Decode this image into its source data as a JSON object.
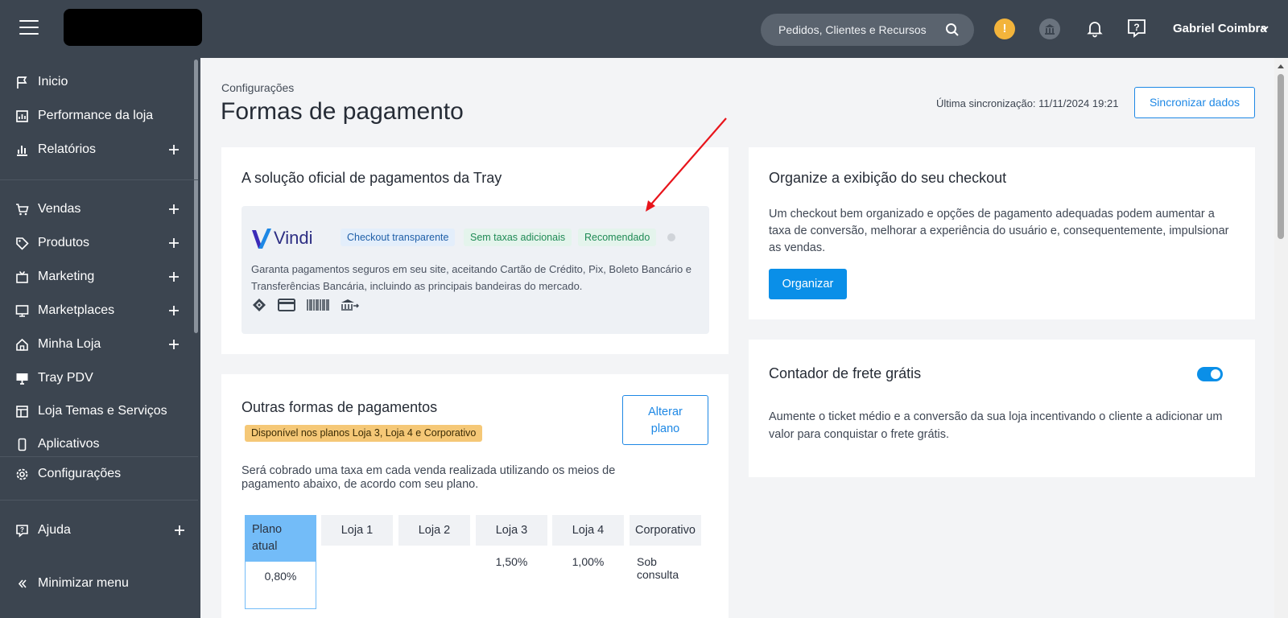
{
  "topbar": {
    "search_placeholder": "Pedidos, Clientes e Recursos",
    "alert_glyph": "!",
    "user_name": "Gabriel Coimbra"
  },
  "sidebar": {
    "items": [
      {
        "label": "Inicio",
        "icon": "flag-icon",
        "expandable": false
      },
      {
        "label": "Performance da loja",
        "icon": "chart-board-icon",
        "expandable": false
      },
      {
        "label": "Relatórios",
        "icon": "bar-chart-icon",
        "expandable": true
      },
      {
        "label": "Vendas",
        "icon": "cart-icon",
        "expandable": true
      },
      {
        "label": "Produtos",
        "icon": "tag-icon",
        "expandable": true
      },
      {
        "label": "Marketing",
        "icon": "tv-icon",
        "expandable": true
      },
      {
        "label": "Marketplaces",
        "icon": "monitor-icon",
        "expandable": true
      },
      {
        "label": "Minha Loja",
        "icon": "home-icon",
        "expandable": true
      },
      {
        "label": "Tray PDV",
        "icon": "pos-icon",
        "expandable": false
      },
      {
        "label": "Loja Temas e Serviços",
        "icon": "layout-icon",
        "expandable": false
      },
      {
        "label": "Aplicativos",
        "icon": "phone-icon",
        "expandable": false
      },
      {
        "label": "Configurações",
        "icon": "gear-icon",
        "expandable": false
      },
      {
        "label": "Ajuda",
        "icon": "help-icon",
        "expandable": true
      },
      {
        "label": "Minimizar menu",
        "icon": "double-chevron-left-icon",
        "expandable": false
      }
    ]
  },
  "main": {
    "breadcrumb": "Configurações",
    "title": "Formas de pagamento",
    "sync_label": "Última sincronização: 11/11/2024 19:21",
    "sync_button": "Sincronizar dados"
  },
  "tray_card": {
    "title": "A solução oficial de pagamentos da Tray",
    "vindi": {
      "logo_text": "Vindi",
      "chips": [
        "Checkout transparente",
        "Sem taxas adicionais",
        "Recomendado"
      ],
      "description": "Garanta pagamentos seguros em seu site, aceitando Cartão de Crédito, Pix, Boleto Bancário e Transferências Bancária, incluindo as principais bandeiras do mercado.",
      "payment_icons": [
        "pix-icon",
        "credit-card-icon",
        "barcode-icon",
        "bank-transfer-icon"
      ]
    }
  },
  "other_card": {
    "title": "Outras formas de pagamentos",
    "badge": "Disponível nos planos Loja 3, Loja 4 e Corporativo",
    "button_line1": "Alterar",
    "button_line2": "plano",
    "text": "Será cobrado uma taxa em cada venda realizada utilizando os meios de pagamento abaixo, de acordo com seu plano.",
    "plans": [
      {
        "name": "Plano atual",
        "value": "0,80%"
      },
      {
        "name": "Loja 1",
        "value": ""
      },
      {
        "name": "Loja 2",
        "value": ""
      },
      {
        "name": "Loja 3",
        "value": "1,50%"
      },
      {
        "name": "Loja 4",
        "value": "1,00%"
      },
      {
        "name": "Corporativo",
        "value": "Sob consulta"
      }
    ]
  },
  "checkout_card": {
    "title": "Organize a exibição do seu checkout",
    "text": "Um checkout bem organizado e opções de pagamento adequadas podem aumentar a taxa de conversão, melhorar a experiência do usuário e, consequentemente, impulsionar as vendas.",
    "button": "Organizar"
  },
  "freight_card": {
    "title": "Contador de frete grátis",
    "text": "Aumente o ticket médio e a conversão da sua loja incentivando o cliente a adicionar um valor para conquistar o frete grátis.",
    "toggle_on": true
  },
  "colors": {
    "topbar": "#3c4550",
    "accent": "#0a8fe8",
    "warning_badge": "#f5c877",
    "annotation_arrow": "#e8141b"
  }
}
